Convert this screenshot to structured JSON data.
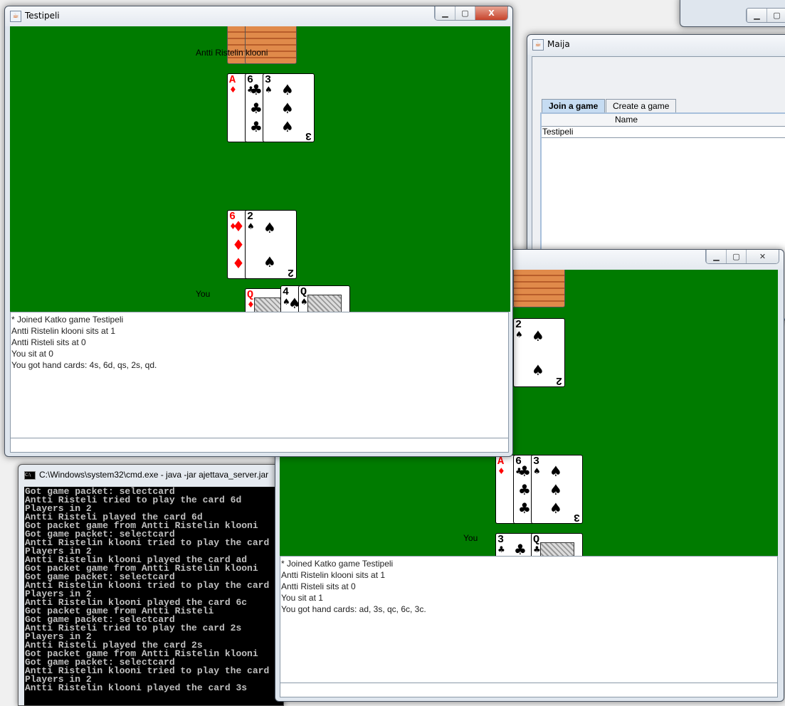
{
  "colors": {
    "felt": "#007b00",
    "card_red": "#ff0000",
    "console_bg": "#000000",
    "console_fg": "#c0c0c0",
    "tab_selected": "#c6dcf2"
  },
  "maija": {
    "title": "Maija",
    "tabs": [
      {
        "label": "Join a game",
        "selected": true
      },
      {
        "label": "Create a game",
        "selected": false
      }
    ],
    "table": {
      "columns": [
        "Name"
      ],
      "rows": [
        [
          "Testipeli"
        ]
      ]
    }
  },
  "cmd": {
    "title": "C:\\Windows\\system32\\cmd.exe - java  -jar ajettava_server.jar",
    "lines": [
      "Got game packet: selectcard",
      "Antti Risteli tried to play the card 6d",
      "Players in 2",
      "Antti Risteli played the card 6d",
      "Got packet game from Antti Ristelin klooni",
      "Got game packet: selectcard",
      "Antti Ristelin klooni tried to play the card",
      "Players in 2",
      "Antti Ristelin klooni played the card ad",
      "Got packet game from Antti Ristelin klooni",
      "Got game packet: selectcard",
      "Antti Ristelin klooni tried to play the card",
      "Players in 2",
      "Antti Ristelin klooni played the card 6c",
      "Got packet game from Antti Risteli",
      "Got game packet: selectcard",
      "Antti Risteli tried to play the card 2s",
      "Players in 2",
      "Antti Risteli played the card 2s",
      "Got packet game from Antti Ristelin klooni",
      "Got game packet: selectcard",
      "Antti Ristelin klooni tried to play the card",
      "Players in 2",
      "Antti Ristelin klooni played the card 3s"
    ]
  },
  "game1": {
    "title": "Testipeli",
    "opponent_name": "Antti Ristelin klooni",
    "you_label": "You",
    "opponent_hidden_cards": 2,
    "opponent_played": [
      {
        "rank": "A",
        "suit": "♦"
      },
      {
        "rank": "6",
        "suit": "♣"
      },
      {
        "rank": "3",
        "suit": "♠"
      }
    ],
    "my_played": [
      {
        "rank": "6",
        "suit": "♦"
      },
      {
        "rank": "2",
        "suit": "♠"
      }
    ],
    "hand": [
      {
        "rank": "Q",
        "suit": "♦"
      },
      {
        "rank": "4",
        "suit": "♠"
      },
      {
        "rank": "Q",
        "suit": "♠"
      }
    ],
    "log": [
      "* Joined Katko game Testipeli",
      "Antti Ristelin klooni sits at 1",
      "Antti Risteli sits at 0",
      "You sit at 0",
      "You got hand cards: 4s, 6d, qs, 2s, qd."
    ],
    "input": ""
  },
  "game2": {
    "title": "",
    "you_label": "You",
    "opponent_hidden_cards": 2,
    "opponent_played": [
      {
        "rank": "2",
        "suit": "♠"
      }
    ],
    "my_played": [
      {
        "rank": "A",
        "suit": "♦"
      },
      {
        "rank": "6",
        "suit": "♣"
      },
      {
        "rank": "3",
        "suit": "♠"
      }
    ],
    "hand": [
      {
        "rank": "3",
        "suit": "♣"
      },
      {
        "rank": "Q",
        "suit": "♣"
      }
    ],
    "log": [
      "* Joined Katko game Testipeli",
      "Antti Ristelin klooni sits at 1",
      "Antti Risteli sits at 0",
      "You sit at 1",
      "You got hand cards: ad, 3s, qc, 6c, 3c."
    ],
    "input": ""
  }
}
